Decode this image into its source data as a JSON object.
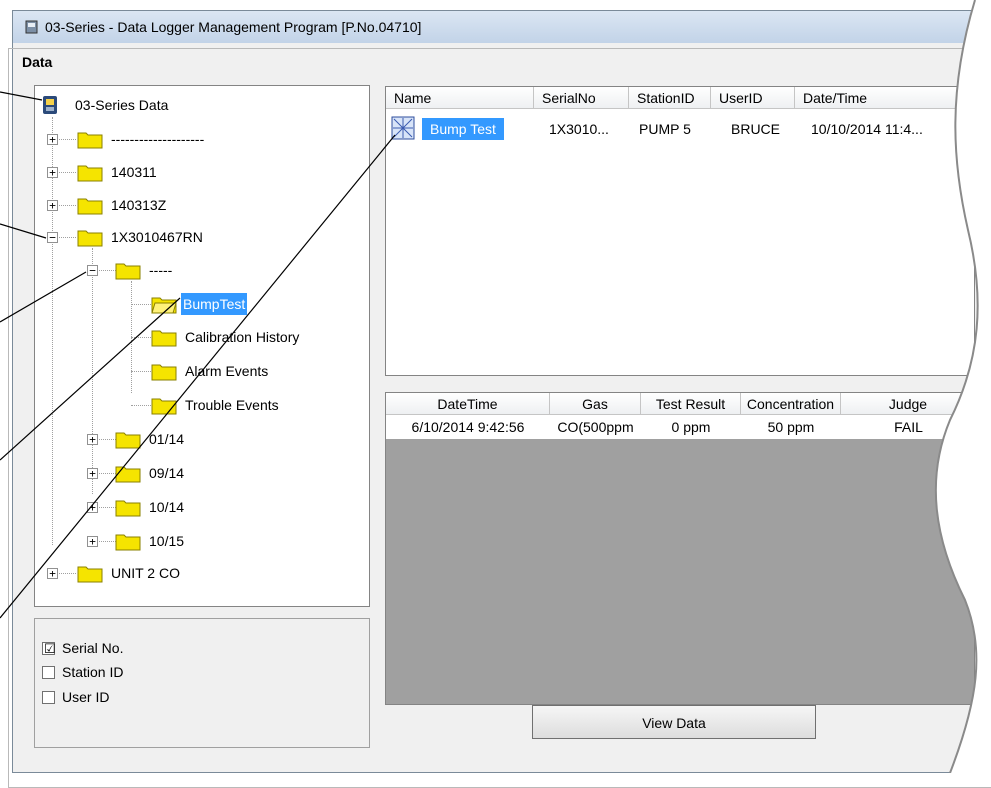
{
  "window": {
    "title": "03-Series  - Data Logger Management Program [P.No.04710]"
  },
  "group": {
    "label": "Data"
  },
  "tree": {
    "root": "03-Series Data",
    "items": [
      {
        "label": "--------------------"
      },
      {
        "label": "140311"
      },
      {
        "label": "140313Z"
      },
      {
        "label": "1X3010467RN"
      },
      {
        "label": "-----"
      },
      {
        "label": "BumpTest"
      },
      {
        "label": "Calibration History"
      },
      {
        "label": "Alarm Events"
      },
      {
        "label": "Trouble Events"
      },
      {
        "label": "01/14"
      },
      {
        "label": "09/14"
      },
      {
        "label": "10/14"
      },
      {
        "label": "10/15"
      },
      {
        "label": "UNIT 2 CO"
      }
    ]
  },
  "options": {
    "serial": {
      "label": "Serial No.",
      "checked": "☑"
    },
    "station": {
      "label": "Station ID"
    },
    "user": {
      "label": "User ID"
    }
  },
  "top_list": {
    "columns": [
      "Name",
      "SerialNo",
      "StationID",
      "UserID",
      "Date/Time"
    ],
    "rows": [
      {
        "name": "Bump Test",
        "serial": "1X3010...",
        "station": "PUMP 5",
        "user": "BRUCE",
        "datetime": "10/10/2014 11:4..."
      }
    ]
  },
  "bottom_list": {
    "columns": [
      "DateTime",
      "Gas",
      "Test Result",
      "Concentration",
      "Judge"
    ],
    "rows": [
      {
        "datetime": "6/10/2014 9:42:56",
        "gas": "CO(500ppm",
        "result": "0 ppm",
        "conc": "50 ppm",
        "judge": "FAIL"
      }
    ]
  },
  "buttons": {
    "view_data": "View Data"
  },
  "colors": {
    "selection": "#3399ff",
    "folder": "#f5e400",
    "grey_area": "#a0a0a0"
  }
}
